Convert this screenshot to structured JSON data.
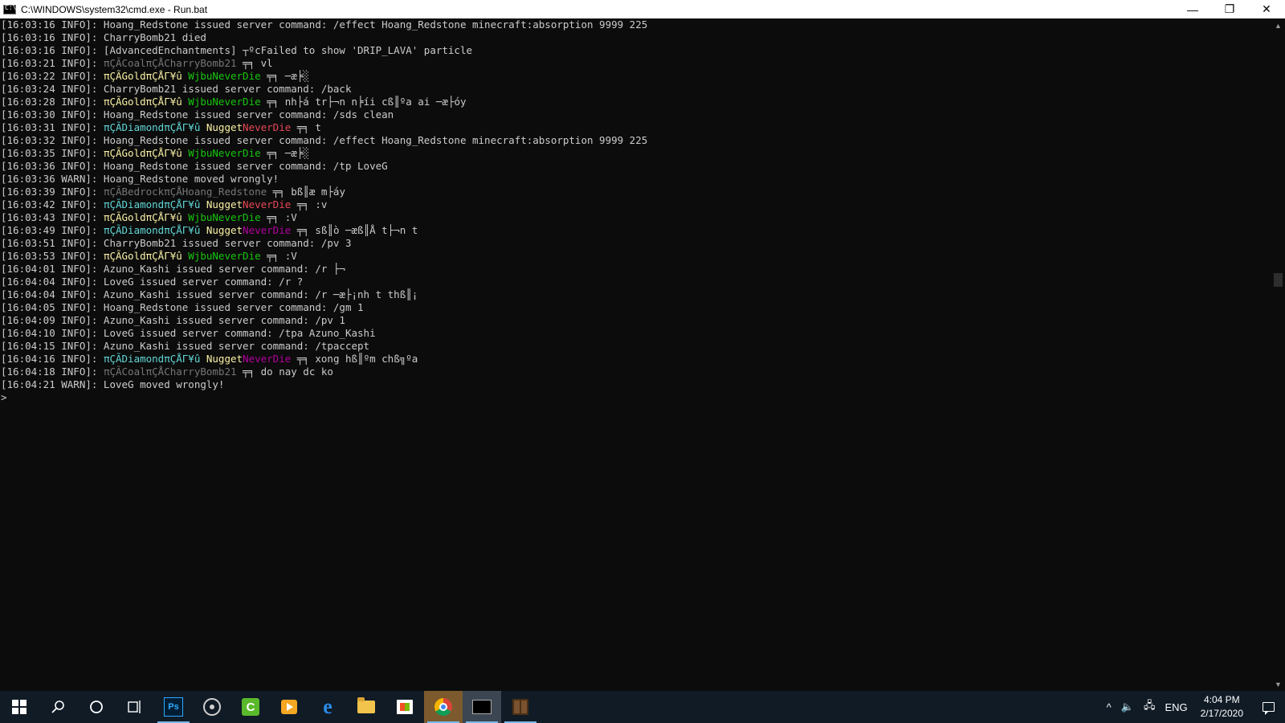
{
  "window": {
    "title": "C:\\WINDOWS\\system32\\cmd.exe - Run.bat",
    "icon": "cmd-icon",
    "minimize_glyph": "—",
    "maximize_glyph": "❐",
    "close_glyph": "✕"
  },
  "colors": {
    "console_bg": "#0c0c0c",
    "console_text": "#cccccc",
    "gray": "#767676",
    "gold": "#f9f1a5",
    "green": "#16c60c",
    "aqua": "#61d6d6",
    "red": "#e74856",
    "pink": "#b4009e",
    "taskbar_bg": "#101b26"
  },
  "console": {
    "lines": [
      [
        {
          "t": "[16:03:16 INFO]: Hoang_Redstone issued server command: /effect Hoang_Redstone minecraft:absorption 9999 225",
          "c": "white"
        }
      ],
      [
        {
          "t": "[16:03:16 INFO]: CharryBomb21 died",
          "c": "white"
        }
      ],
      [
        {
          "t": "[16:03:16 INFO]: [AdvancedEnchantments] ┬ºcFailed to show 'DRIP_LAVA' particle",
          "c": "white"
        }
      ],
      [
        {
          "t": "[16:03:21 INFO]: ",
          "c": "white"
        },
        {
          "t": "πÇÃCoalπÇÅCharryBomb21",
          "c": "gray"
        },
        {
          "t": " ╤╕ vl",
          "c": "white"
        }
      ],
      [
        {
          "t": "[16:03:22 INFO]: ",
          "c": "white"
        },
        {
          "t": "πÇÃGoldπÇÅΓ¥û",
          "c": "gold"
        },
        {
          "t": " WjbuNeverDie",
          "c": "green"
        },
        {
          "t": " ╤╕ ─æ╞░",
          "c": "white"
        }
      ],
      [
        {
          "t": "[16:03:24 INFO]: CharryBomb21 issued server command: /back",
          "c": "white"
        }
      ],
      [
        {
          "t": "[16:03:28 INFO]: ",
          "c": "white"
        },
        {
          "t": "πÇÃGoldπÇÅΓ¥û",
          "c": "gold"
        },
        {
          "t": " WjbuNeverDie",
          "c": "green"
        },
        {
          "t": " ╤╕ nh├á tr├¬n n╞íi cß║ºa ai ─æ├óy",
          "c": "white"
        }
      ],
      [
        {
          "t": "[16:03:30 INFO]: Hoang_Redstone issued server command: /sds clean",
          "c": "white"
        }
      ],
      [
        {
          "t": "[16:03:31 INFO]: ",
          "c": "white"
        },
        {
          "t": "πÇÃDiamondπÇÅΓ¥û",
          "c": "aqua"
        },
        {
          "t": " Nugget",
          "c": "yellow"
        },
        {
          "t": "NeverDie",
          "c": "red"
        },
        {
          "t": " ╤╕ t",
          "c": "white"
        }
      ],
      [
        {
          "t": "[16:03:32 INFO]: Hoang_Redstone issued server command: /effect Hoang_Redstone minecraft:absorption 9999 225",
          "c": "white"
        }
      ],
      [
        {
          "t": "[16:03:35 INFO]: ",
          "c": "white"
        },
        {
          "t": "πÇÃGoldπÇÅΓ¥û",
          "c": "gold"
        },
        {
          "t": " WjbuNeverDie",
          "c": "green"
        },
        {
          "t": " ╤╕ ─æ╞░",
          "c": "white"
        }
      ],
      [
        {
          "t": "[16:03:36 INFO]: Hoang_Redstone issued server command: /tp LoveG",
          "c": "white"
        }
      ],
      [
        {
          "t": "[16:03:36 WARN]: Hoang_Redstone moved wrongly!",
          "c": "white"
        }
      ],
      [
        {
          "t": "[16:03:39 INFO]: ",
          "c": "white"
        },
        {
          "t": "πÇÃBedrockπÇÅHoang_Redstone",
          "c": "gray"
        },
        {
          "t": " ╤╕ bß║æ m├áy",
          "c": "white"
        }
      ],
      [
        {
          "t": "[16:03:42 INFO]: ",
          "c": "white"
        },
        {
          "t": "πÇÃDiamondπÇÅΓ¥û",
          "c": "aqua"
        },
        {
          "t": " Nugget",
          "c": "yellow"
        },
        {
          "t": "NeverDie",
          "c": "red"
        },
        {
          "t": " ╤╕ :v",
          "c": "white"
        }
      ],
      [
        {
          "t": "[16:03:43 INFO]: ",
          "c": "white"
        },
        {
          "t": "πÇÃGoldπÇÅΓ¥û",
          "c": "gold"
        },
        {
          "t": " WjbuNeverDie",
          "c": "green"
        },
        {
          "t": " ╤╕ :V",
          "c": "white"
        }
      ],
      [
        {
          "t": "[16:03:49 INFO]: ",
          "c": "white"
        },
        {
          "t": "πÇÃDiamondπÇÅΓ¥û",
          "c": "aqua"
        },
        {
          "t": " Nugget",
          "c": "yellow"
        },
        {
          "t": "NeverDie",
          "c": "pink"
        },
        {
          "t": " ╤╕ sß║ò ─æß║Å t├¬n t",
          "c": "white"
        }
      ],
      [
        {
          "t": "[16:03:51 INFO]: CharryBomb21 issued server command: /pv 3",
          "c": "white"
        }
      ],
      [
        {
          "t": "[16:03:53 INFO]: ",
          "c": "white"
        },
        {
          "t": "πÇÃGoldπÇÅΓ¥û",
          "c": "gold"
        },
        {
          "t": " WjbuNeverDie",
          "c": "green"
        },
        {
          "t": " ╤╕ :V",
          "c": "white"
        }
      ],
      [
        {
          "t": "[16:04:01 INFO]: Azuno_Kashi issued server command: /r ├¬",
          "c": "white"
        }
      ],
      [
        {
          "t": "[16:04:04 INFO]: LoveG issued server command: /r ?",
          "c": "white"
        }
      ],
      [
        {
          "t": "[16:04:04 INFO]: Azuno_Kashi issued server command: /r ─æ├¡nh t thß║¡",
          "c": "white"
        }
      ],
      [
        {
          "t": "[16:04:05 INFO]: Hoang_Redstone issued server command: /gm 1",
          "c": "white"
        }
      ],
      [
        {
          "t": "[16:04:09 INFO]: Azuno_Kashi issued server command: /pv 1",
          "c": "white"
        }
      ],
      [
        {
          "t": "[16:04:10 INFO]: LoveG issued server command: /tpa Azuno_Kashi",
          "c": "white"
        }
      ],
      [
        {
          "t": "[16:04:15 INFO]: Azuno_Kashi issued server command: /tpaccept",
          "c": "white"
        }
      ],
      [
        {
          "t": "[16:04:16 INFO]: ",
          "c": "white"
        },
        {
          "t": "πÇÃDiamondπÇÅΓ¥û",
          "c": "aqua"
        },
        {
          "t": " Nugget",
          "c": "yellow"
        },
        {
          "t": "NeverDie",
          "c": "pink"
        },
        {
          "t": " ╤╕ xong hß║ºm chß╗ºa",
          "c": "white"
        }
      ],
      [
        {
          "t": "[16:04:18 INFO]: ",
          "c": "white"
        },
        {
          "t": "πÇÃCoalπÇÅCharryBomb21",
          "c": "gray"
        },
        {
          "t": " ╤╕ do nay dc ko",
          "c": "white"
        }
      ],
      [
        {
          "t": "[16:04:21 WARN]: LoveG moved wrongly!",
          "c": "white"
        }
      ],
      [
        {
          "t": ">",
          "c": "white"
        }
      ]
    ]
  },
  "scrollbar": {
    "up_glyph": "▲",
    "down_glyph": "▼"
  },
  "taskbar": {
    "apps": [
      {
        "name": "start-button",
        "icon": "windows-logo-icon"
      },
      {
        "name": "search-button",
        "icon": "search-icon"
      },
      {
        "name": "cortana-button",
        "icon": "cortana-icon"
      },
      {
        "name": "task-view-button",
        "icon": "task-view-icon"
      },
      {
        "name": "photoshop-button",
        "icon": "photoshop-icon",
        "label": "Ps"
      },
      {
        "name": "obs-button",
        "icon": "obs-icon"
      },
      {
        "name": "camtasia-button",
        "icon": "camtasia-icon",
        "label": "C"
      },
      {
        "name": "video-button",
        "icon": "video-icon"
      },
      {
        "name": "edge-button",
        "icon": "edge-icon",
        "label": "e"
      },
      {
        "name": "file-explorer-button",
        "icon": "folder-icon"
      },
      {
        "name": "store-button",
        "icon": "store-icon"
      },
      {
        "name": "chrome-button",
        "icon": "chrome-icon"
      },
      {
        "name": "cmd-button",
        "icon": "cmd-icon"
      },
      {
        "name": "minecraft-button",
        "icon": "minecraft-icon"
      }
    ],
    "tray": {
      "chevron": "^",
      "volume_glyph": "🔈",
      "network_glyph": "🖧",
      "language": "ENG",
      "time": "4:04 PM",
      "date": "2/17/2020"
    }
  }
}
